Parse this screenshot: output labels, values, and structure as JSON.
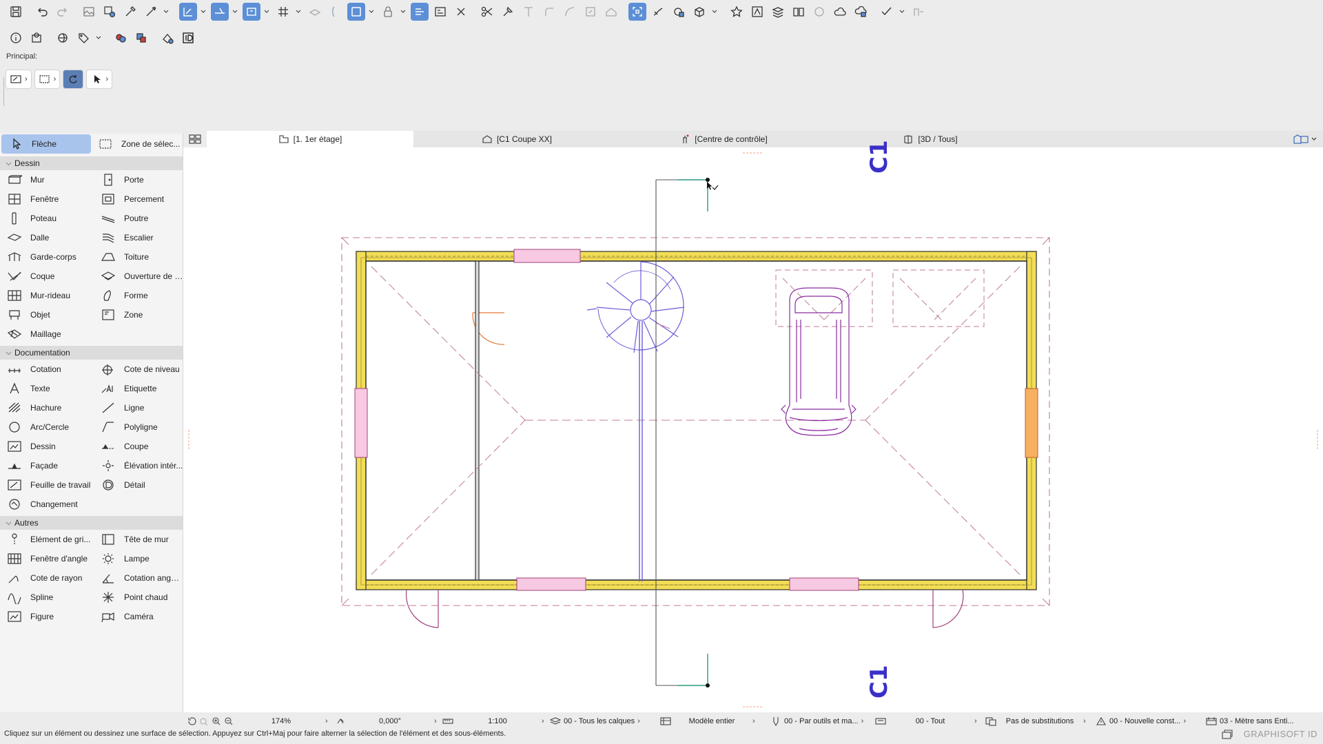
{
  "window": {
    "principal_label": "Principal:"
  },
  "toolbox": {
    "top": [
      {
        "label": "Flèche",
        "icon": "arrow-pointer-icon",
        "selected": true
      },
      {
        "label": "Zone de sélec...",
        "icon": "marquee-icon",
        "selected": false
      }
    ],
    "sections": [
      {
        "title": "Dessin",
        "tools": [
          {
            "label": "Mur",
            "icon": "wall-icon"
          },
          {
            "label": "Porte",
            "icon": "door-icon"
          },
          {
            "label": "Fenêtre",
            "icon": "window-icon"
          },
          {
            "label": "Percement",
            "icon": "opening-icon"
          },
          {
            "label": "Poteau",
            "icon": "column-icon"
          },
          {
            "label": "Poutre",
            "icon": "beam-icon"
          },
          {
            "label": "Dalle",
            "icon": "slab-icon"
          },
          {
            "label": "Escalier",
            "icon": "stair-icon"
          },
          {
            "label": "Garde-corps",
            "icon": "railing-icon"
          },
          {
            "label": "Toiture",
            "icon": "roof-icon"
          },
          {
            "label": "Coque",
            "icon": "shell-icon"
          },
          {
            "label": "Ouverture de t...",
            "icon": "skylight-icon"
          },
          {
            "label": "Mur-rideau",
            "icon": "curtain-wall-icon"
          },
          {
            "label": "Forme",
            "icon": "morph-icon"
          },
          {
            "label": "Objet",
            "icon": "object-icon"
          },
          {
            "label": "Zone",
            "icon": "zone-icon"
          },
          {
            "label": "Maillage",
            "icon": "mesh-icon"
          }
        ]
      },
      {
        "title": "Documentation",
        "tools": [
          {
            "label": "Cotation",
            "icon": "dimension-icon"
          },
          {
            "label": "Cote de niveau",
            "icon": "level-dimension-icon"
          },
          {
            "label": "Texte",
            "icon": "text-icon"
          },
          {
            "label": "Etiquette",
            "icon": "label-icon"
          },
          {
            "label": "Hachure",
            "icon": "fill-icon"
          },
          {
            "label": "Ligne",
            "icon": "line-icon"
          },
          {
            "label": "Arc/Cercle",
            "icon": "arc-circle-icon"
          },
          {
            "label": "Polyligne",
            "icon": "polyline-icon"
          },
          {
            "label": "Dessin",
            "icon": "drawing-icon"
          },
          {
            "label": "Coupe",
            "icon": "section-icon"
          },
          {
            "label": "Façade",
            "icon": "elevation-icon"
          },
          {
            "label": "Élévation intér...",
            "icon": "interior-elevation-icon"
          },
          {
            "label": "Feuille de travail",
            "icon": "worksheet-icon"
          },
          {
            "label": "Détail",
            "icon": "detail-icon"
          },
          {
            "label": "Changement",
            "icon": "change-icon"
          }
        ]
      },
      {
        "title": "Autres",
        "tools": [
          {
            "label": "Elément de gri...",
            "icon": "grid-element-icon"
          },
          {
            "label": "Tête de mur",
            "icon": "wall-end-icon"
          },
          {
            "label": "Fenêtre d'angle",
            "icon": "corner-window-icon"
          },
          {
            "label": "Lampe",
            "icon": "lamp-icon"
          },
          {
            "label": "Cote de rayon",
            "icon": "radial-dimension-icon"
          },
          {
            "label": "Cotation angul...",
            "icon": "angle-dimension-icon"
          },
          {
            "label": "Spline",
            "icon": "spline-icon"
          },
          {
            "label": "Point chaud",
            "icon": "hotspot-icon"
          },
          {
            "label": "Figure",
            "icon": "figure-icon"
          },
          {
            "label": "Caméra",
            "icon": "camera-icon"
          }
        ]
      }
    ]
  },
  "tabs": [
    {
      "label": "[1. 1er étage]",
      "icon": "floor-plan-icon",
      "active": true
    },
    {
      "label": "[C1 Coupe XX]",
      "icon": "section-view-icon",
      "active": false
    },
    {
      "label": "[Centre de contrôle]",
      "icon": "control-center-icon",
      "active": false
    },
    {
      "label": "[3D / Tous]",
      "icon": "3d-view-icon",
      "active": false
    }
  ],
  "canvas": {
    "section_marker": "C1"
  },
  "statusbar": {
    "zoom": "174%",
    "angle": "0,000°",
    "scale": "1:100",
    "layers": "00 - Tous les calques",
    "model": "Modèle entier",
    "pen_set": "00 - Par outils et ma...",
    "structure": "00 - Tout",
    "overrides": "Pas de substitutions",
    "renovation": "00 - Nouvelle const...",
    "dimension": "03 - Mètre sans Enti..."
  },
  "message": "Cliquez sur un élément ou dessinez une surface de sélection. Appuyez sur Ctrl+Maj pour faire alterner la sélection de l'élément et des sous-éléments.",
  "brand": "GRAPHISOFT ID",
  "colors": {
    "accent": "#5c8fd6",
    "wall_fill": "#f2dd55",
    "annotation": "#b0608a",
    "stair": "#6a5cd8",
    "car": "#8a2aa0"
  }
}
